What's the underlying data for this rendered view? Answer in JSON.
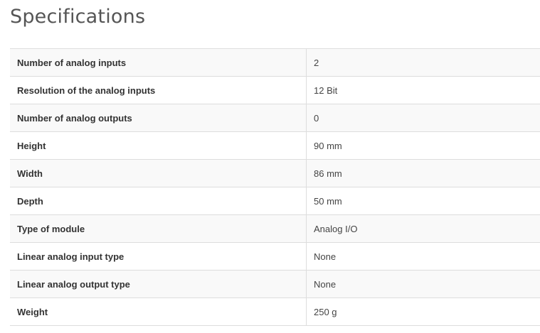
{
  "title": "Specifications",
  "specs": [
    {
      "label": "Number of analog inputs",
      "value": "2"
    },
    {
      "label": "Resolution of the analog inputs",
      "value": "12 Bit"
    },
    {
      "label": "Number of analog outputs",
      "value": "0"
    },
    {
      "label": "Height",
      "value": "90 mm"
    },
    {
      "label": "Width",
      "value": "86 mm"
    },
    {
      "label": "Depth",
      "value": "50 mm"
    },
    {
      "label": "Type of module",
      "value": "Analog I/O"
    },
    {
      "label": "Linear analog input type",
      "value": "None"
    },
    {
      "label": "Linear analog output type",
      "value": "None"
    },
    {
      "label": "Weight",
      "value": "250 g"
    }
  ]
}
